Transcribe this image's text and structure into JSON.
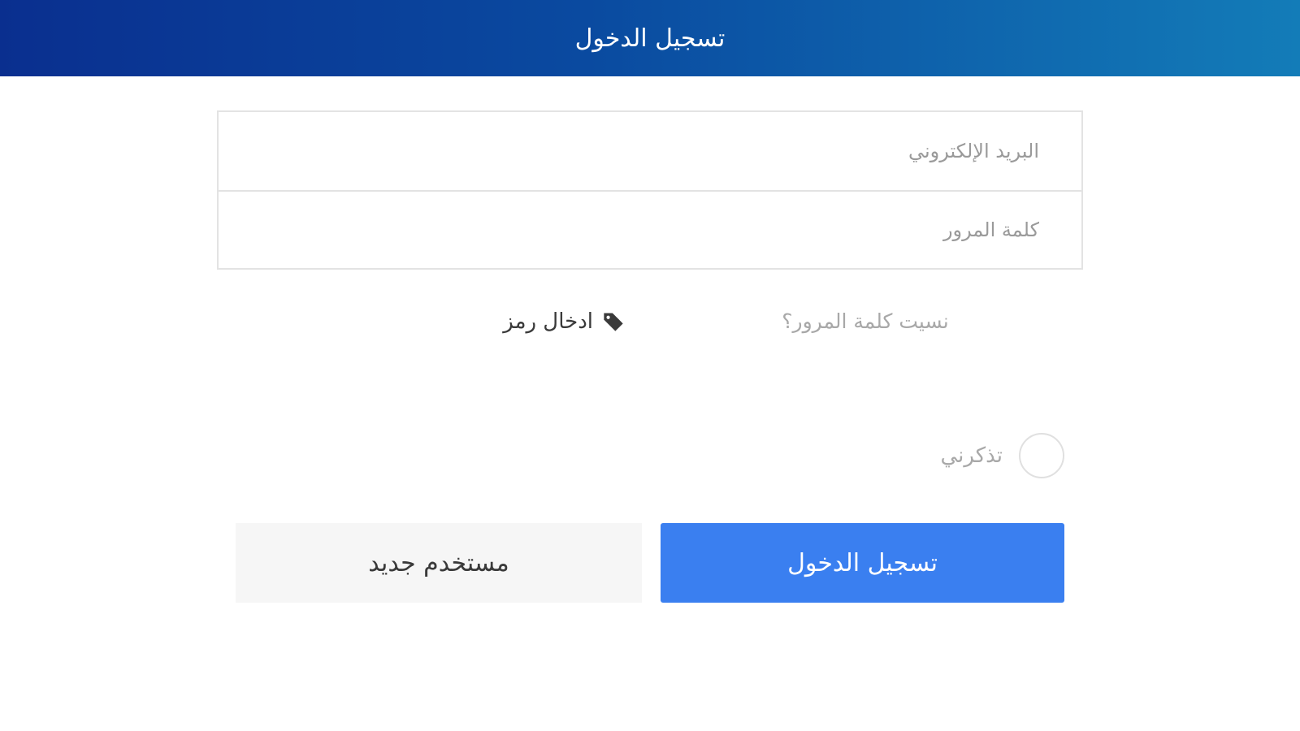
{
  "header": {
    "title": "تسجيل الدخول"
  },
  "form": {
    "email_placeholder": "البريد الإلكتروني",
    "password_placeholder": "كلمة المرور"
  },
  "links": {
    "forgot_password": "نسيت كلمة المرور؟",
    "enter_code": "ادخال رمز",
    "enter_code_icon": "tag-icon"
  },
  "remember": {
    "label": "تذكرني",
    "checked": false
  },
  "buttons": {
    "login": "تسجيل الدخول",
    "new_user": "مستخدم جديد"
  },
  "colors": {
    "header_gradient_start": "#0a2f8f",
    "header_gradient_end": "#137cb8",
    "primary_button": "#3a7ff0",
    "secondary_button": "#f6f6f6"
  }
}
